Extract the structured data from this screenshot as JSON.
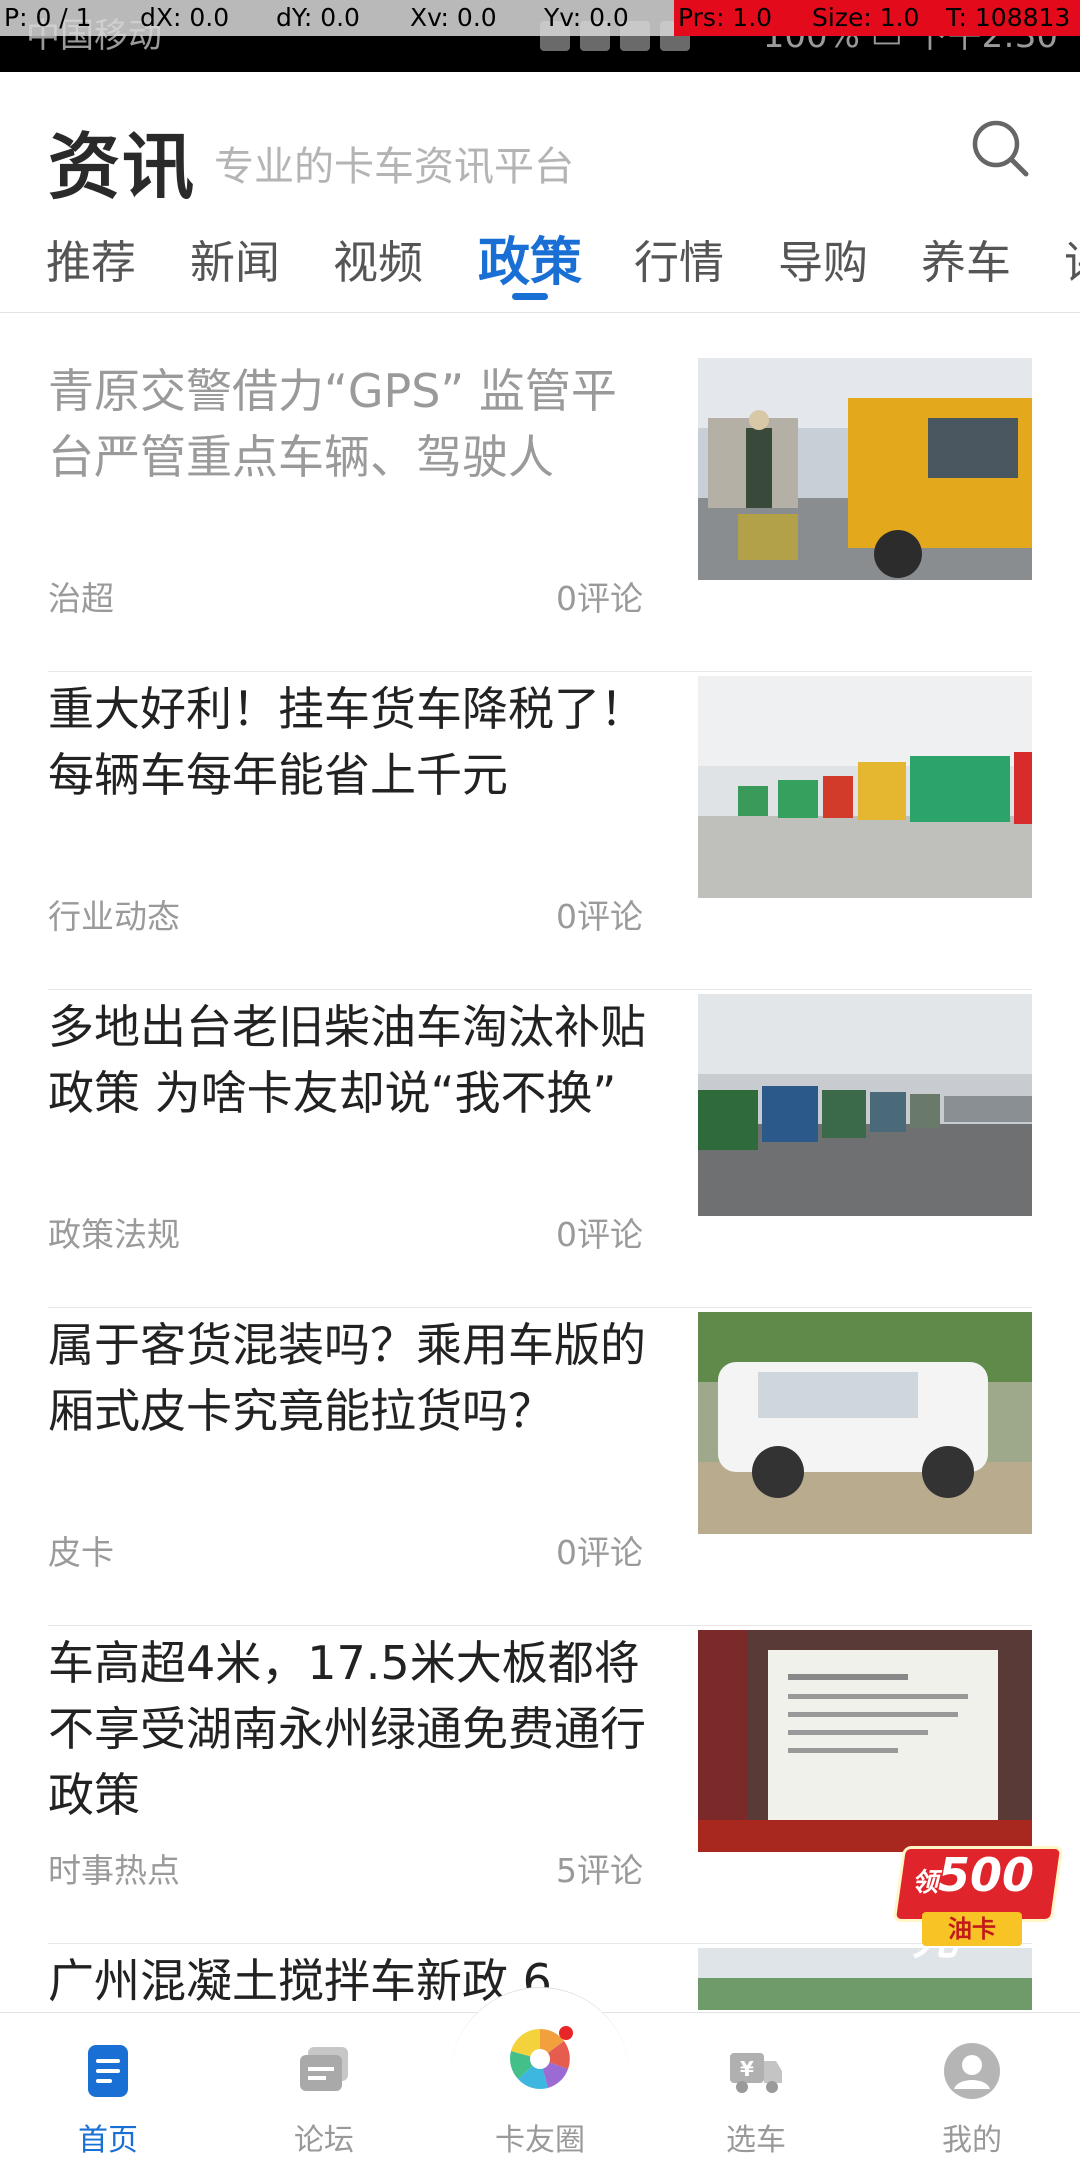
{
  "status_bar": {
    "carrier": "中国移动",
    "battery": "100%",
    "time": "下午2:30",
    "debug": {
      "pointer": "P: 0 / 1",
      "dx": "dX: 0.0",
      "dy": "dY: 0.0",
      "xv": "Xv: 0.0",
      "yv": "Yv: 0.0",
      "prs": "Prs: 1.0",
      "size": "Size: 1.0",
      "t": "T: 108813"
    }
  },
  "header": {
    "title": "资讯",
    "subtitle": "专业的卡车资讯平台",
    "search_icon": "search-icon"
  },
  "tabs": [
    {
      "label": "推荐",
      "active": false
    },
    {
      "label": "新闻",
      "active": false
    },
    {
      "label": "视频",
      "active": false
    },
    {
      "label": "政策",
      "active": true
    },
    {
      "label": "行情",
      "active": false
    },
    {
      "label": "导购",
      "active": false
    },
    {
      "label": "养车",
      "active": false
    },
    {
      "label": "评",
      "active": false
    }
  ],
  "articles": [
    {
      "title": "青原交警借力“GPS” 监管平台严管重点车辆、驾驶人",
      "tag": "治超",
      "comments": "0评论",
      "read": true,
      "thumb": "traffic-police-truck"
    },
    {
      "title": "重大好利！挂车货车降税了！每辆车每年能省上千元",
      "tag": "行业动态",
      "comments": "0评论",
      "read": false,
      "thumb": "parked-trailers"
    },
    {
      "title": "多地出台老旧柴油车淘汰补贴政策 为啥卡友却说“我不换”",
      "tag": "政策法规",
      "comments": "0评论",
      "read": false,
      "thumb": "truck-lot"
    },
    {
      "title": "属于客货混装吗？乘用车版的厢式皮卡究竟能拉货吗？",
      "tag": "皮卡",
      "comments": "0评论",
      "read": false,
      "thumb": "white-pickup"
    },
    {
      "title": "车高超4米，17.5米大板都将不享受湖南永州绿通免费通行政策",
      "tag": "时事热点",
      "comments": "5评论",
      "read": false,
      "thumb": "notice-sign"
    },
    {
      "title": "广州混凝土搅拌车新政 6",
      "tag": "",
      "comments": "",
      "read": false,
      "thumb": "city-road"
    }
  ],
  "promo": {
    "amount": "500元",
    "prefix": "领",
    "label": "油卡"
  },
  "bottom_nav": [
    {
      "label": "首页",
      "icon": "home-doc-icon",
      "active": true
    },
    {
      "label": "论坛",
      "icon": "forum-icon",
      "active": false
    },
    {
      "label": "卡友圈",
      "icon": "pinwheel-icon",
      "active": false
    },
    {
      "label": "选车",
      "icon": "truck-price-icon",
      "active": false
    },
    {
      "label": "我的",
      "icon": "profile-icon",
      "active": false
    }
  ],
  "colors": {
    "accent": "#1a6fd4",
    "muted_text": "#9a9a9a",
    "promo_red": "#e0242b"
  }
}
